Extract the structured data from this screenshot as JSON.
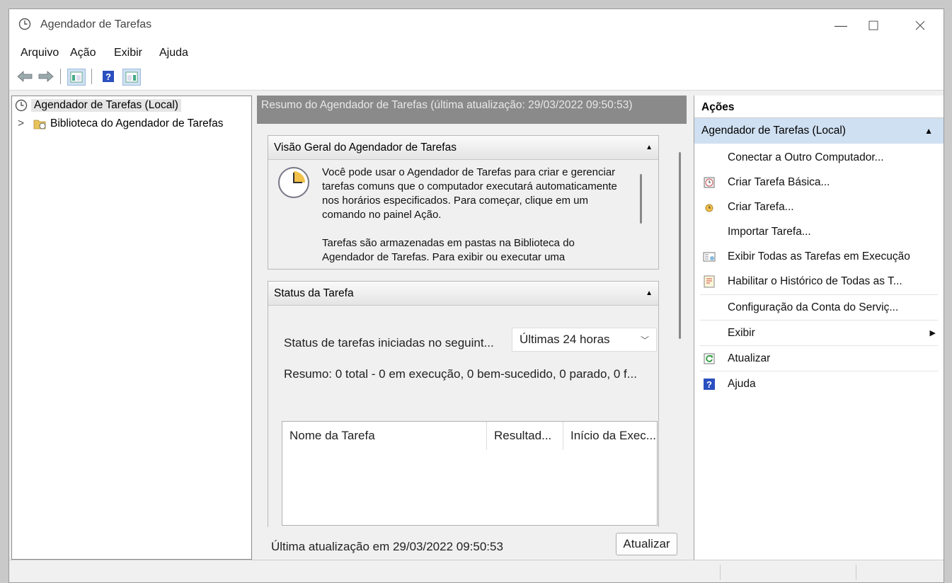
{
  "window": {
    "title": "Agendador de Tarefas"
  },
  "menu": [
    "Arquivo",
    "Ação",
    "Exibir",
    "Ajuda"
  ],
  "tree": {
    "root": "Agendador de Tarefas (Local)",
    "child": "Biblioteca do Agendador de Tarefas",
    "expander": ">"
  },
  "center": {
    "header": "Resumo do Agendador de Tarefas (última atualização: 29/03/2022 09:50:53)",
    "overview": {
      "title": "Visão Geral do Agendador de Tarefas",
      "para1": "Você pode usar o Agendador de Tarefas para criar e gerenciar tarefas comuns que o computador executará automaticamente nos horários especificados. Para começar, clique em um comando no painel Ação.",
      "para2": "Tarefas são armazenadas em pastas na Biblioteca do Agendador de Tarefas. Para exibir ou executar uma"
    },
    "status": {
      "title": "Status da Tarefa",
      "filter_label": "Status de tarefas iniciadas no seguint...",
      "filter_value": "Últimas 24 horas",
      "summary": "Resumo: 0 total - 0 em execução, 0 bem-sucedido, 0 parado, 0 f...",
      "columns": [
        "Nome da Tarefa",
        "Resultad...",
        "Início da Exec..."
      ]
    },
    "footer": {
      "last_update": "Última atualização em 29/03/2022 09:50:53",
      "refresh_button": "Atualizar"
    }
  },
  "actions": {
    "title": "Ações",
    "group": "Agendador de Tarefas (Local)",
    "items": [
      {
        "label": "Conectar a Outro Computador...",
        "icon": "none"
      },
      {
        "label": "Criar Tarefa Básica...",
        "icon": "basic-task-icon"
      },
      {
        "label": "Criar Tarefa...",
        "icon": "create-task-icon"
      },
      {
        "label": "Importar Tarefa...",
        "icon": "none"
      },
      {
        "label": "Exibir Todas as Tarefas em Execução",
        "icon": "running-tasks-icon"
      },
      {
        "label": "Habilitar o Histórico de Todas as T...",
        "icon": "history-icon"
      },
      {
        "label": "Configuração da Conta do Serviç...",
        "icon": "none"
      },
      {
        "label": "Exibir",
        "icon": "none"
      },
      {
        "label": "Atualizar",
        "icon": "refresh-icon"
      },
      {
        "label": "Ajuda",
        "icon": "help-icon"
      }
    ]
  },
  "colors": {
    "accent": "#cfe0f2",
    "header_gray": "#8a8a8a",
    "window_bg": "#f0f0f0"
  }
}
